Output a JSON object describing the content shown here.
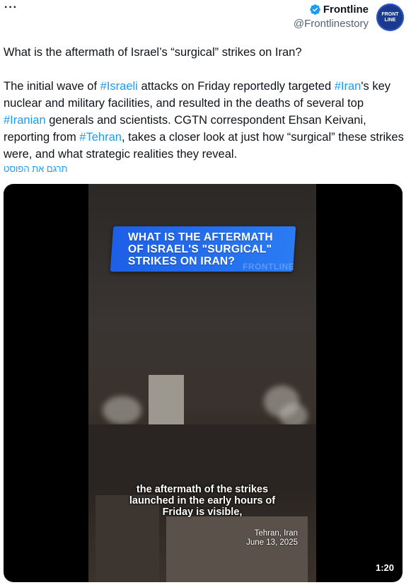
{
  "header": {
    "more_label": "···",
    "author_name": "Frontline",
    "author_handle": "@Frontlinestory",
    "avatar_text_line1": "FRONT",
    "avatar_text_line2": "LINE",
    "verified_color": "#1d9bf0"
  },
  "tweet": {
    "headline": "What is the aftermath of Israel’s “surgical” strikes on Iran?",
    "body": {
      "t1": "The initial wave of ",
      "tag_israeli": "#Israeli",
      "t2": " attacks on Friday reportedly targeted ",
      "tag_iran": "#Iran",
      "t3": "'s key nuclear and military facilities, and resulted in the deaths of several top ",
      "tag_iranian": "#Iranian",
      "t4": " generals and scientists. CGTN correspondent Ehsan Keivani, reporting from ",
      "tag_tehran": "#Tehran",
      "t5": ", takes a closer look at just how “surgical” these strikes were, and what strategic realities they reveal."
    },
    "translate_label": "תרגם את הפוסט",
    "link_color": "#1d9bf0"
  },
  "media": {
    "video_title": "WHAT IS THE AFTERMATH\nOF ISRAEL'S \"SURGICAL\"\nSTRIKES ON IRAN?",
    "watermark": "FRONTLINE",
    "caption": "the aftermath of the strikes\nlaunched in the early hours of\nFriday is visible,",
    "location": "Tehran, Iran",
    "date": "June 13, 2025",
    "duration": "1:20",
    "accent_color": "#1d5fe6"
  }
}
